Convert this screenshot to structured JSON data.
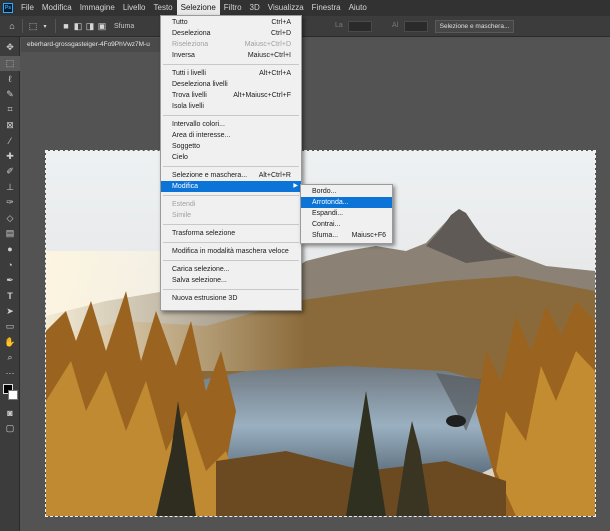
{
  "menubar": {
    "logo": "Ps",
    "items": [
      "File",
      "Modifica",
      "Immagine",
      "Livello",
      "Testo",
      "Selezione",
      "Filtro",
      "3D",
      "Visualizza",
      "Finestra",
      "Aiuto"
    ]
  },
  "options": {
    "feather_label": "Sfuma",
    "la_label": "La",
    "al_label": "Al",
    "select_mask_button": "Selezione e maschera..."
  },
  "document": {
    "tab_title": "eberhard-grossgasteiger-4Fo9PhVwz7M-u"
  },
  "selection_menu": {
    "items": [
      {
        "label": "Tutto",
        "shortcut": "Ctrl+A",
        "disabled": false
      },
      {
        "label": "Deseleziona",
        "shortcut": "Ctrl+D",
        "disabled": false
      },
      {
        "label": "Riseleziona",
        "shortcut": "Maiusc+Ctrl+D",
        "disabled": true
      },
      {
        "label": "Inversa",
        "shortcut": "Maiusc+Ctrl+I",
        "disabled": false
      },
      {
        "sep": true
      },
      {
        "label": "Tutti i livelli",
        "shortcut": "Alt+Ctrl+A",
        "disabled": false
      },
      {
        "label": "Deseleziona livelli",
        "shortcut": "",
        "disabled": false
      },
      {
        "label": "Trova livelli",
        "shortcut": "Alt+Maiusc+Ctrl+F",
        "disabled": false
      },
      {
        "label": "Isola livelli",
        "shortcut": "",
        "disabled": false
      },
      {
        "sep": true
      },
      {
        "label": "Intervallo colori...",
        "shortcut": "",
        "disabled": false
      },
      {
        "label": "Area di interesse...",
        "shortcut": "",
        "disabled": false
      },
      {
        "label": "Soggetto",
        "shortcut": "",
        "disabled": false
      },
      {
        "label": "Cielo",
        "shortcut": "",
        "disabled": false
      },
      {
        "sep": true
      },
      {
        "label": "Selezione e maschera...",
        "shortcut": "Alt+Ctrl+R",
        "disabled": false
      },
      {
        "label": "Modifica",
        "shortcut": "",
        "disabled": false,
        "highlight": true,
        "submenu": true
      },
      {
        "sep": true
      },
      {
        "label": "Estendi",
        "shortcut": "",
        "disabled": true
      },
      {
        "label": "Simile",
        "shortcut": "",
        "disabled": true
      },
      {
        "sep": true
      },
      {
        "label": "Trasforma selezione",
        "shortcut": "",
        "disabled": false
      },
      {
        "sep": true
      },
      {
        "label": "Modifica in modalità maschera veloce",
        "shortcut": "",
        "disabled": false
      },
      {
        "sep": true
      },
      {
        "label": "Carica selezione...",
        "shortcut": "",
        "disabled": false
      },
      {
        "label": "Salva selezione...",
        "shortcut": "",
        "disabled": false
      },
      {
        "sep": true
      },
      {
        "label": "Nuova estrusione 3D",
        "shortcut": "",
        "disabled": false
      }
    ]
  },
  "modify_submenu": {
    "items": [
      {
        "label": "Bordo...",
        "shortcut": "",
        "highlight": false
      },
      {
        "label": "Arrotonda...",
        "shortcut": "",
        "highlight": true
      },
      {
        "label": "Espandi...",
        "shortcut": "",
        "highlight": false
      },
      {
        "label": "Contrai...",
        "shortcut": "",
        "highlight": false
      },
      {
        "label": "Sfuma...",
        "shortcut": "Maiusc+F6",
        "highlight": false
      }
    ]
  },
  "tools": [
    "move-icon",
    "marquee-icon",
    "lasso-icon",
    "quick-select-icon",
    "crop-icon",
    "frame-icon",
    "eyedropper-icon",
    "healing-icon",
    "brush-icon",
    "clone-stamp-icon",
    "history-brush-icon",
    "eraser-icon",
    "gradient-icon",
    "blur-icon",
    "dodge-icon",
    "pen-icon",
    "type-icon",
    "path-select-icon",
    "shape-icon",
    "hand-icon",
    "zoom-icon",
    "more-icon",
    "color-swatch-icon",
    "quick-mask-icon",
    "screen-mode-icon"
  ],
  "colors": {
    "menubar": "#323232",
    "panel": "#3c3c3c",
    "workspace": "#535353",
    "menu_highlight": "#0b74d6"
  }
}
